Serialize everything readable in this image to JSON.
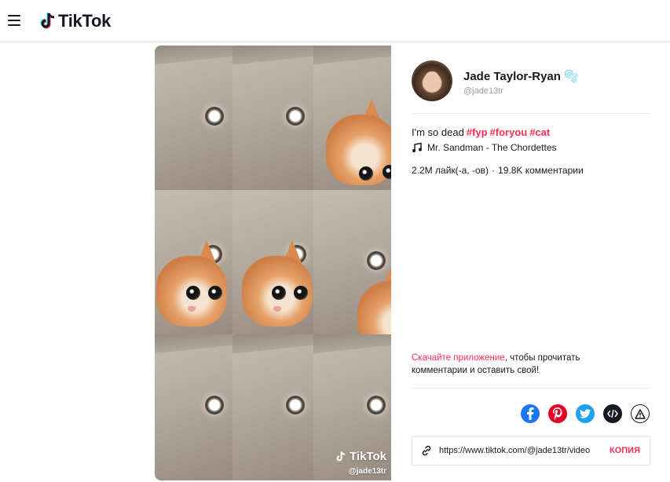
{
  "header": {
    "logo_text": "TikTok"
  },
  "video": {
    "watermark_text": "TikTok",
    "watermark_handle": "@jade13tr"
  },
  "author": {
    "name": "Jade Taylor-Ryan 🫧",
    "handle": "@jade13tr"
  },
  "post": {
    "caption": "I'm so dead",
    "hashtags": [
      "#fyp",
      "#foryou",
      "#cat"
    ],
    "music": "Mr. Sandman - The Chordettes",
    "likes": "2.2M лайк(-а, -ов)",
    "separator": "·",
    "comments": "19.8K комментарии"
  },
  "cta": {
    "link_text": "Скачайте приложение",
    "rest_text": ", чтобы прочитать комментарии и оставить свой!"
  },
  "share": {
    "icons": [
      "facebook-icon",
      "pinterest-icon",
      "twitter-icon",
      "embed-icon",
      "report-icon"
    ],
    "colors": {
      "facebook": "#1877f2",
      "pinterest": "#e60023",
      "twitter": "#1da1f2",
      "dark": "#161823"
    }
  },
  "link": {
    "url": "https://www.tiktok.com/@jade13tr/video",
    "copy_label": "КОПИЯ"
  }
}
